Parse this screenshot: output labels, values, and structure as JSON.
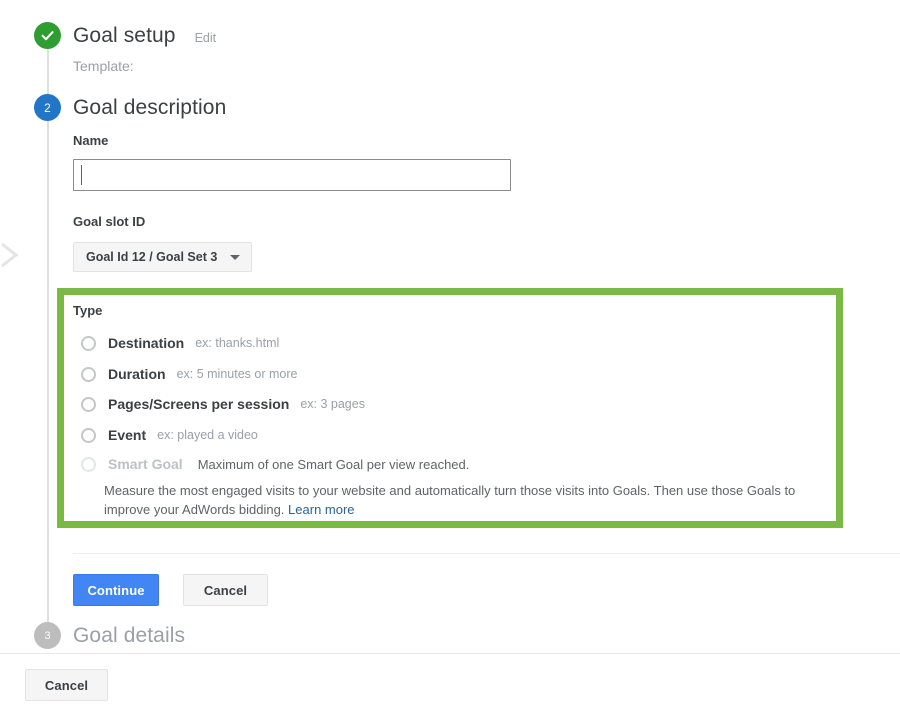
{
  "colors": {
    "accent_green": "#7ab944",
    "step_done_green": "#2e9e32",
    "step_active_blue": "#2176c7",
    "step_pending_grey": "#bdbdbd",
    "primary_button_blue": "#4285f4",
    "link_blue": "#2a6496"
  },
  "collapse_handle": {
    "icon": "chevron-right-icon"
  },
  "steps": {
    "step1": {
      "badge_state": "completed",
      "badge_icon": "checkmark-icon",
      "title": "Goal setup",
      "edit_link": "Edit",
      "template_line": "Template:"
    },
    "step2": {
      "badge_number": "2",
      "title": "Goal description",
      "name": {
        "label": "Name",
        "value": "",
        "placeholder": ""
      },
      "goal_slot": {
        "label": "Goal slot ID",
        "selected": "Goal Id 12 / Goal Set 3",
        "caret_icon": "chevron-down-icon"
      },
      "type": {
        "label": "Type",
        "options": [
          {
            "label": "Destination",
            "hint": "ex: thanks.html",
            "selected": false,
            "disabled": false
          },
          {
            "label": "Duration",
            "hint": "ex: 5 minutes or more",
            "selected": false,
            "disabled": false
          },
          {
            "label": "Pages/Screens per session",
            "hint": "ex: 3 pages",
            "selected": false,
            "disabled": false
          },
          {
            "label": "Event",
            "hint": "ex: played a video",
            "selected": false,
            "disabled": false
          },
          {
            "label": "Smart Goal",
            "hint": "Maximum of one Smart Goal per view reached.",
            "selected": false,
            "disabled": true
          }
        ],
        "smart_goal_description": "Measure the most engaged visits to your website and automatically turn those visits into Goals. Then use those Goals to improve your AdWords bidding.",
        "smart_goal_link": "Learn more"
      },
      "actions": {
        "continue_label": "Continue",
        "cancel_label": "Cancel"
      }
    },
    "step3": {
      "badge_number": "3",
      "title": "Goal details"
    }
  },
  "footer": {
    "cancel_label": "Cancel"
  }
}
